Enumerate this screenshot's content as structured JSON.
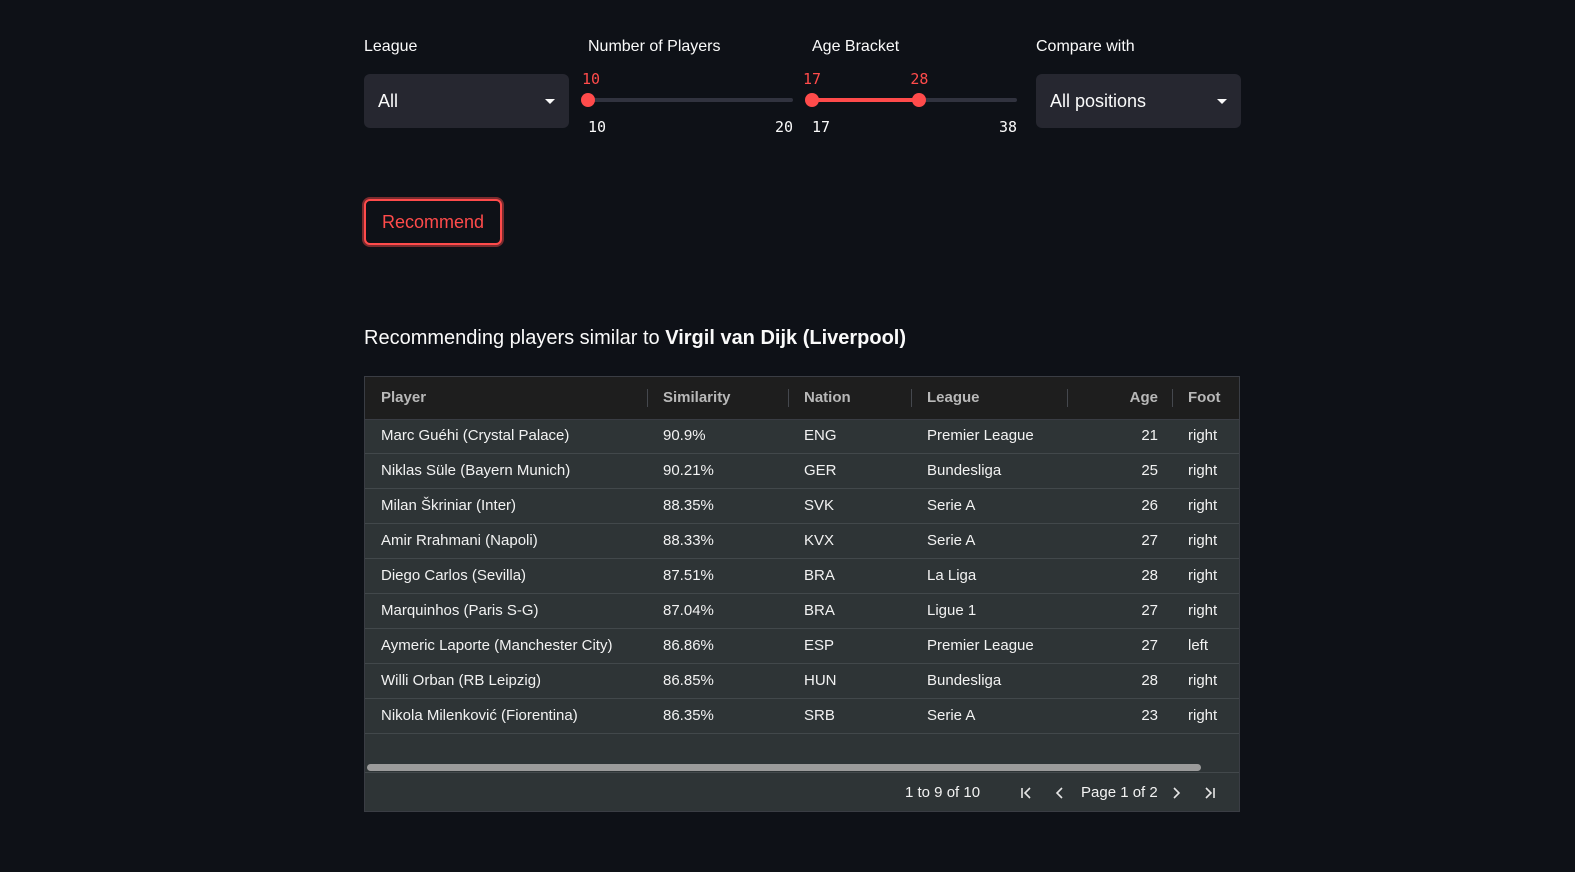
{
  "controls": {
    "league": {
      "label": "League",
      "value": "All"
    },
    "num_players": {
      "label": "Number of Players",
      "min": "10",
      "max": "20",
      "value": "10",
      "value_fraction": 0
    },
    "age_bracket": {
      "label": "Age Bracket",
      "min": "17",
      "max": "38",
      "low": "17",
      "high": "28",
      "low_value": 17,
      "high_value": 28,
      "range_min": 17,
      "range_max": 38
    },
    "compare": {
      "label": "Compare with",
      "value": "All positions"
    }
  },
  "button": {
    "label": "Recommend"
  },
  "heading": {
    "prefix": "Recommending players similar to ",
    "player": "Virgil van Dijk (Liverpool)"
  },
  "table": {
    "columns": [
      "Player",
      "Similarity",
      "Nation",
      "League",
      "Age",
      "Foot"
    ],
    "rows": [
      [
        "Marc Guéhi (Crystal Palace)",
        "90.9%",
        "ENG",
        "Premier League",
        "21",
        "right"
      ],
      [
        "Niklas Süle (Bayern Munich)",
        "90.21%",
        "GER",
        "Bundesliga",
        "25",
        "right"
      ],
      [
        "Milan Škriniar (Inter)",
        "88.35%",
        "SVK",
        "Serie A",
        "26",
        "right"
      ],
      [
        "Amir Rrahmani (Napoli)",
        "88.33%",
        "KVX",
        "Serie A",
        "27",
        "right"
      ],
      [
        "Diego Carlos (Sevilla)",
        "87.51%",
        "BRA",
        "La Liga",
        "28",
        "right"
      ],
      [
        "Marquinhos (Paris S-G)",
        "87.04%",
        "BRA",
        "Ligue 1",
        "27",
        "right"
      ],
      [
        "Aymeric Laporte (Manchester City)",
        "86.86%",
        "ESP",
        "Premier League",
        "27",
        "left"
      ],
      [
        "Willi Orban (RB Leipzig)",
        "86.85%",
        "HUN",
        "Bundesliga",
        "28",
        "right"
      ],
      [
        "Nikola Milenković (Fiorentina)",
        "86.35%",
        "SRB",
        "Serie A",
        "23",
        "right"
      ]
    ]
  },
  "pagination": {
    "summary": "1 to 9 of 10",
    "page_label": "Page 1 of 2",
    "icons": [
      "first-page-icon",
      "prev-page-icon",
      "next-page-icon",
      "last-page-icon"
    ]
  },
  "colors": {
    "background": "#0e1117",
    "accent": "#ff4b4b",
    "input_bg": "#262730",
    "table_bg": "#2e3436",
    "header_bg": "#1e1e1e"
  }
}
